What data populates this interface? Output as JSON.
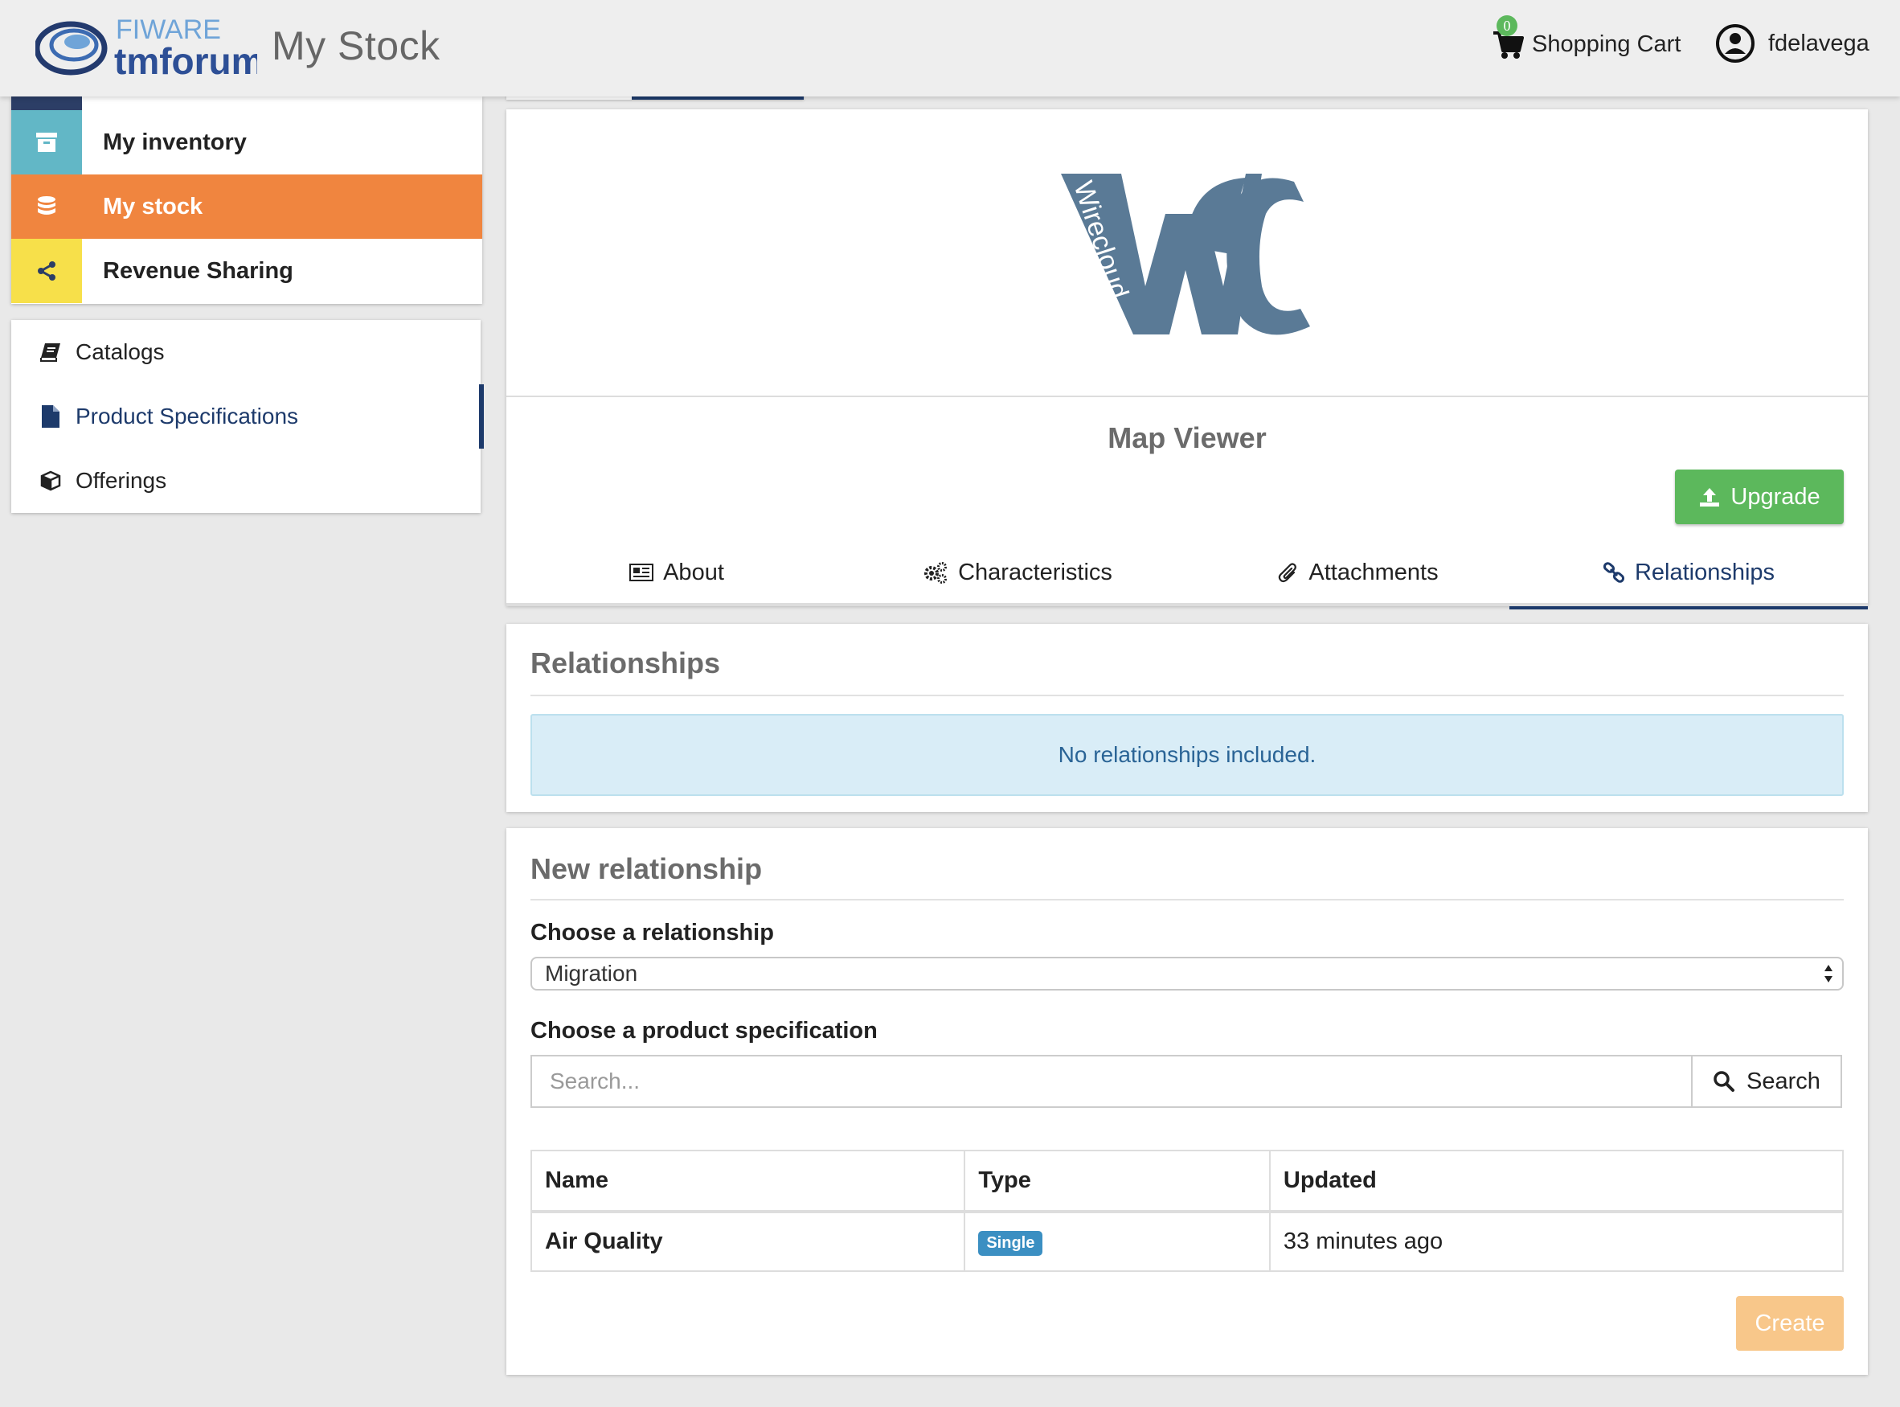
{
  "header": {
    "logo_top": "FIWARE",
    "logo_bottom": "tmforum",
    "title": "My Stock",
    "cart_count": "0",
    "cart_label": "Shopping Cart",
    "user_name": "fdelavega"
  },
  "sidebar": {
    "primary": [
      {
        "label": "My inventory",
        "icon": "archive-icon"
      },
      {
        "label": "My stock",
        "icon": "database-icon"
      },
      {
        "label": "Revenue Sharing",
        "icon": "share-icon"
      }
    ],
    "secondary": [
      {
        "label": "Catalogs",
        "icon": "book-icon"
      },
      {
        "label": "Product Specifications",
        "icon": "file-icon"
      },
      {
        "label": "Offerings",
        "icon": "cube-icon"
      }
    ]
  },
  "product": {
    "logo_text": "Wirecloud",
    "name": "Map Viewer",
    "upgrade_label": "Upgrade",
    "tabs": [
      "About",
      "Characteristics",
      "Attachments",
      "Relationships"
    ],
    "active_tab": "Relationships"
  },
  "relationships": {
    "title": "Relationships",
    "empty_message": "No relationships included."
  },
  "new_relationship": {
    "title": "New relationship",
    "relationship_label": "Choose a relationship",
    "relationship_value": "Migration",
    "spec_label": "Choose a product specification",
    "search_placeholder": "Search...",
    "search_button": "Search",
    "table": {
      "headers": [
        "Name",
        "Type",
        "Updated"
      ],
      "rows": [
        {
          "name": "Air Quality",
          "type": "Single",
          "updated": "33 minutes ago"
        }
      ]
    },
    "create_label": "Create"
  },
  "colors": {
    "accent_navy": "#1d3a6b",
    "inventory": "#62b7c6",
    "stock": "#f0853f",
    "revenue": "#f7e04a",
    "success": "#5cb85c",
    "info_bg": "#d9edf7",
    "create_disabled": "#f8c78a"
  }
}
